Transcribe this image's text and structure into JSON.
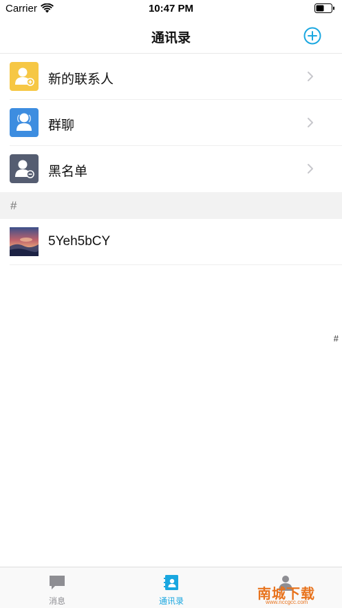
{
  "status_bar": {
    "carrier": "Carrier",
    "time": "10:47 PM"
  },
  "nav": {
    "title": "通讯录",
    "accent_color": "#1aa7e0"
  },
  "list_items": [
    {
      "label": "新的联系人",
      "icon": "add-contact-icon",
      "color": "#f6c744"
    },
    {
      "label": "群聊",
      "icon": "group-chat-icon",
      "color": "#3d8de0"
    },
    {
      "label": "黑名单",
      "icon": "blacklist-icon",
      "color": "#555d71"
    }
  ],
  "section": {
    "header": "#"
  },
  "contacts": [
    {
      "name": "5Yeh5bCY",
      "avatar": "landscape-avatar"
    }
  ],
  "index_bar": [
    "#"
  ],
  "tabs": [
    {
      "label": "消息",
      "icon": "chat-bubble-icon",
      "active": false
    },
    {
      "label": "通讯录",
      "icon": "contacts-book-icon",
      "active": true
    },
    {
      "label": "",
      "icon": "person-icon",
      "active": false
    }
  ],
  "watermark": {
    "title": "南城下载",
    "url": "www.nccgcc.com"
  }
}
